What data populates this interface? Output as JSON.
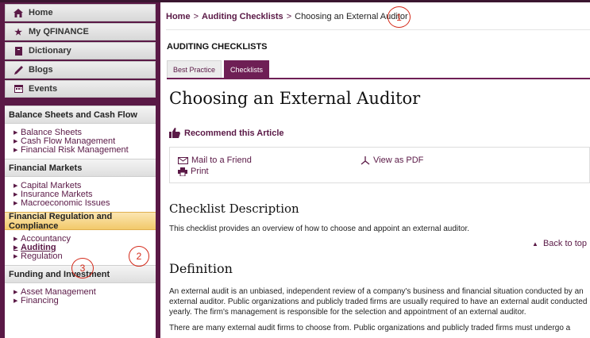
{
  "nav": [
    {
      "label": "Home",
      "icon": "home-icon"
    },
    {
      "label": "My QFINANCE",
      "icon": "star-icon"
    },
    {
      "label": "Dictionary",
      "icon": "book-icon"
    },
    {
      "label": "Blogs",
      "icon": "pen-icon"
    },
    {
      "label": "Events",
      "icon": "calendar-icon"
    }
  ],
  "categories": [
    {
      "title": "Balance Sheets and Cash Flow",
      "links": [
        "Balance Sheets",
        "Cash Flow Management",
        "Financial Risk Management"
      ]
    },
    {
      "title": "Financial Markets",
      "links": [
        "Capital Markets",
        "Insurance Markets",
        "Macroeconomic Issues"
      ]
    },
    {
      "title": "Financial Regulation and Compliance",
      "links": [
        "Accountancy",
        "Auditing",
        "Regulation"
      ]
    },
    {
      "title": "Funding and Investment",
      "links": [
        "Asset Management",
        "Financing"
      ]
    }
  ],
  "breadcrumb": {
    "home": "Home",
    "sep1": ">",
    "section": "Auditing Checklists",
    "sep2": ">",
    "current": "Choosing an External Auditor"
  },
  "annotations": {
    "one": "1",
    "two": "2",
    "three": "3"
  },
  "section_title": "AUDITING CHECKLISTS",
  "tabs": {
    "best_practice": "Best Practice",
    "checklists": "Checklists"
  },
  "page_title": "Choosing an External Auditor",
  "recommend": "Recommend this Article",
  "share": {
    "mail": "Mail to a Friend",
    "print": "Print",
    "pdf": "View as PDF"
  },
  "checklist_description": {
    "heading": "Checklist Description",
    "text": "This checklist provides an overview of how to choose and appoint an external auditor."
  },
  "back_to_top": "Back to top",
  "definition": {
    "heading": "Definition",
    "para1": "An external audit is an unbiased, independent review of a company's business and financial situation conducted by an external auditor. Public organizations and publicly traded firms are usually required to have an external audit conducted yearly. The firm's management is responsible for the selection and appointment of an external auditor.",
    "para2": "There are many external audit firms to choose from. Public organizations and publicly traded firms must undergo a"
  },
  "colors": {
    "brand": "#5a1946",
    "tab_active": "#6e1f55",
    "annotation": "#d42a1a",
    "highlight": "#f2c96a"
  }
}
